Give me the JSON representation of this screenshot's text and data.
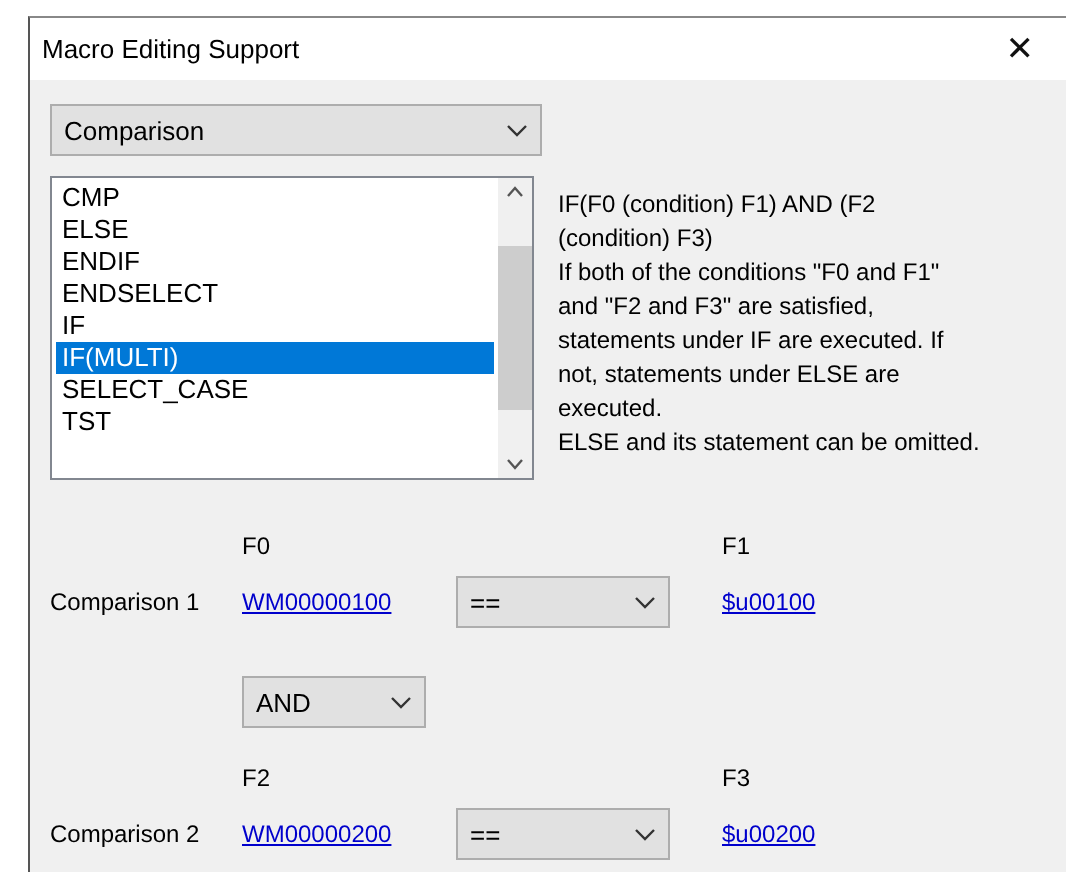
{
  "window": {
    "title": "Macro Editing Support",
    "close": "✕"
  },
  "category": {
    "value": "Comparison"
  },
  "commands": [
    {
      "label": "CMP",
      "selected": false
    },
    {
      "label": "ELSE",
      "selected": false
    },
    {
      "label": "ENDIF",
      "selected": false
    },
    {
      "label": "ENDSELECT",
      "selected": false
    },
    {
      "label": "IF",
      "selected": false
    },
    {
      "label": "IF(MULTI)",
      "selected": true
    },
    {
      "label": "SELECT_CASE",
      "selected": false
    },
    {
      "label": "TST",
      "selected": false
    }
  ],
  "description_lines": [
    "IF(F0 (condition) F1) AND (F2",
    "(condition) F3)",
    "If both of the conditions \"F0 and F1\"",
    "and \"F2 and F3\" are satisfied,",
    "statements under IF are executed. If",
    "not, statements under ELSE are",
    "executed.",
    "ELSE and its statement can be omitted."
  ],
  "comparisons": [
    {
      "label": "Comparison 1",
      "left_heading": "F0",
      "left_value": "WM00000100",
      "operator": "==",
      "right_heading": "F1",
      "right_value": "$u00100"
    },
    {
      "label": "Comparison 2",
      "left_heading": "F2",
      "left_value": "WM00000200",
      "operator": "==",
      "right_heading": "F3",
      "right_value": "$u00200"
    }
  ],
  "logic": {
    "value": "AND"
  }
}
